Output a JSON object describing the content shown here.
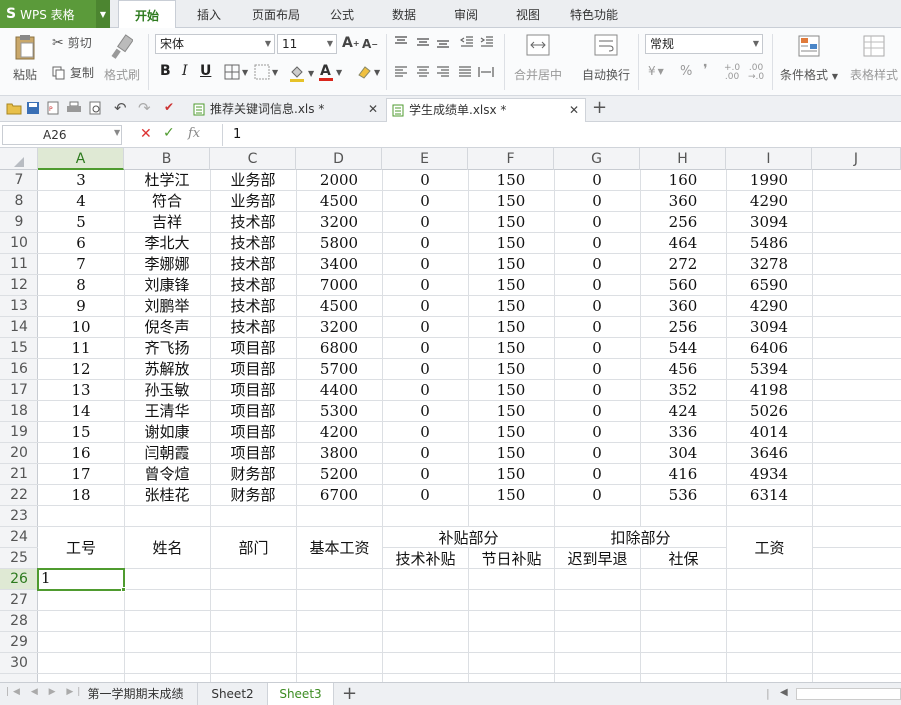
{
  "app": {
    "brand": "WPS 表格",
    "brand_s": "S"
  },
  "menu": [
    "开始",
    "插入",
    "页面布局",
    "公式",
    "数据",
    "审阅",
    "视图",
    "特色功能"
  ],
  "ribbon": {
    "paste": "粘贴",
    "cut": "剪切",
    "copy": "复制",
    "format_painter": "格式刷",
    "font_name": "宋体",
    "font_size": "11",
    "bold": "B",
    "italic": "I",
    "underline": "U",
    "merge_center": "合并居中",
    "wrap_text": "自动换行",
    "number_format": "常规",
    "percent": "%",
    "conditional_format": "条件格式",
    "table_style": "表格样式"
  },
  "doc_tabs": [
    {
      "name": "推荐关键词信息.xls *"
    },
    {
      "name": "学生成绩单.xlsx *"
    }
  ],
  "formula_bar": {
    "cell_ref": "A26",
    "content": "1",
    "fx": "fx"
  },
  "columns": [
    "A",
    "B",
    "C",
    "D",
    "E",
    "F",
    "G",
    "H",
    "I",
    "J"
  ],
  "rows": [
    {
      "n": "7",
      "cells": [
        "3",
        "杜学江",
        "业务部",
        "2000",
        "0",
        "150",
        "0",
        "160",
        "1990"
      ]
    },
    {
      "n": "8",
      "cells": [
        "4",
        "符合",
        "业务部",
        "4500",
        "0",
        "150",
        "0",
        "360",
        "4290"
      ]
    },
    {
      "n": "9",
      "cells": [
        "5",
        "吉祥",
        "技术部",
        "3200",
        "0",
        "150",
        "0",
        "256",
        "3094"
      ]
    },
    {
      "n": "10",
      "cells": [
        "6",
        "李北大",
        "技术部",
        "5800",
        "0",
        "150",
        "0",
        "464",
        "5486"
      ]
    },
    {
      "n": "11",
      "cells": [
        "7",
        "李娜娜",
        "技术部",
        "3400",
        "0",
        "150",
        "0",
        "272",
        "3278"
      ]
    },
    {
      "n": "12",
      "cells": [
        "8",
        "刘康锋",
        "技术部",
        "7000",
        "0",
        "150",
        "0",
        "560",
        "6590"
      ]
    },
    {
      "n": "13",
      "cells": [
        "9",
        "刘鹏举",
        "技术部",
        "4500",
        "0",
        "150",
        "0",
        "360",
        "4290"
      ]
    },
    {
      "n": "14",
      "cells": [
        "10",
        "倪冬声",
        "技术部",
        "3200",
        "0",
        "150",
        "0",
        "256",
        "3094"
      ]
    },
    {
      "n": "15",
      "cells": [
        "11",
        "齐飞扬",
        "项目部",
        "6800",
        "0",
        "150",
        "0",
        "544",
        "6406"
      ]
    },
    {
      "n": "16",
      "cells": [
        "12",
        "苏解放",
        "项目部",
        "5700",
        "0",
        "150",
        "0",
        "456",
        "5394"
      ]
    },
    {
      "n": "17",
      "cells": [
        "13",
        "孙玉敏",
        "项目部",
        "4400",
        "0",
        "150",
        "0",
        "352",
        "4198"
      ]
    },
    {
      "n": "18",
      "cells": [
        "14",
        "王清华",
        "项目部",
        "5300",
        "0",
        "150",
        "0",
        "424",
        "5026"
      ]
    },
    {
      "n": "19",
      "cells": [
        "15",
        "谢如康",
        "项目部",
        "4200",
        "0",
        "150",
        "0",
        "336",
        "4014"
      ]
    },
    {
      "n": "20",
      "cells": [
        "16",
        "闫朝霞",
        "项目部",
        "3800",
        "0",
        "150",
        "0",
        "304",
        "3646"
      ]
    },
    {
      "n": "21",
      "cells": [
        "17",
        "曾令煊",
        "财务部",
        "5200",
        "0",
        "150",
        "0",
        "416",
        "4934"
      ]
    },
    {
      "n": "22",
      "cells": [
        "18",
        "张桂花",
        "财务部",
        "6700",
        "0",
        "150",
        "0",
        "536",
        "6314"
      ]
    },
    {
      "n": "23",
      "cells": []
    },
    {
      "n": "24",
      "cells": []
    },
    {
      "n": "25",
      "cells": []
    },
    {
      "n": "26",
      "cells": []
    },
    {
      "n": "27",
      "cells": []
    },
    {
      "n": "28",
      "cells": []
    },
    {
      "n": "29",
      "cells": []
    },
    {
      "n": "30",
      "cells": []
    }
  ],
  "header_block": {
    "id": "工号",
    "name": "姓名",
    "dept": "部门",
    "base": "基本工资",
    "allowance": "补贴部分",
    "tech": "技术补贴",
    "holiday": "节日补贴",
    "deduction": "扣除部分",
    "late": "迟到早退",
    "social": "社保",
    "wage": "工资"
  },
  "active_cell_value": "1",
  "sheets": [
    "第一学期期末成绩",
    "Sheet2",
    "Sheet3"
  ],
  "colors": {
    "accent": "#4f9b2f",
    "brand": "#5b9a3a"
  }
}
